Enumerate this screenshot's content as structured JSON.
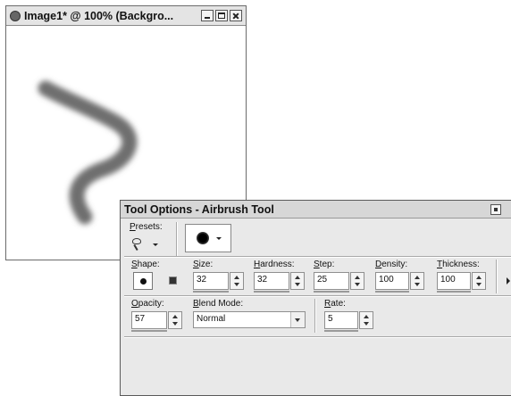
{
  "image_window": {
    "title": "Image1* @ 100% (Backgro..."
  },
  "tool_options": {
    "title": "Tool Options - Airbrush Tool",
    "presets_label": "Presets:",
    "shape_label": "Shape:",
    "size": {
      "label": "Size:",
      "value": "32"
    },
    "hardness": {
      "label": "Hardness:",
      "value": "32"
    },
    "step": {
      "label": "Step:",
      "value": "25"
    },
    "density": {
      "label": "Density:",
      "value": "100"
    },
    "thickness": {
      "label": "Thickness:",
      "value": "100"
    },
    "opacity": {
      "label": "Opacity:",
      "value": "57"
    },
    "blend_mode": {
      "label": "Blend Mode:",
      "value": "Normal"
    },
    "rate": {
      "label": "Rate:",
      "value": "5"
    }
  },
  "icons": {
    "app": "image-doc-icon",
    "presets": "airbrush-preset-icon",
    "brush_tip": "round-brush-tip-icon"
  },
  "colors": {
    "stroke": "#6e6e6e",
    "palette_bg": "#e9e9e9"
  }
}
